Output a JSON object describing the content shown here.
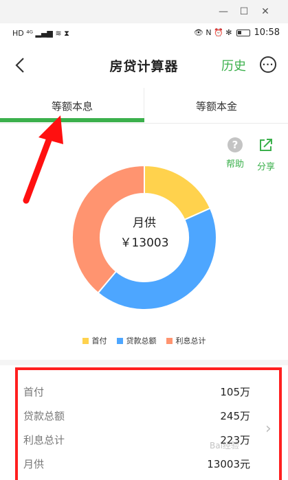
{
  "window": {
    "min": "—",
    "max": "☐",
    "close": "✕"
  },
  "status_bar": {
    "left_glyphs": "HD ⁴ᴳ ▂▄▆ ≋ ⧗",
    "right_glyphs": "👁 N ⏰ ✻",
    "time": "10:58"
  },
  "header": {
    "title": "房贷计算器",
    "history": "历史",
    "more": "···",
    "back": "‹"
  },
  "tabs": [
    {
      "label": "等额本息"
    },
    {
      "label": "等额本金"
    }
  ],
  "actions": {
    "help": "帮助",
    "share": "分享",
    "help_glyph": "?"
  },
  "chart_data": {
    "type": "pie",
    "center_label": "月供",
    "center_value": "￥13003",
    "categories": [
      "首付",
      "贷款总额",
      "利息总计"
    ],
    "values": [
      105,
      245,
      223
    ],
    "colors": [
      "#ffd24d",
      "#4da6ff",
      "#ff9470"
    ]
  },
  "summary": {
    "rows": [
      {
        "label": "首付",
        "value": "105万"
      },
      {
        "label": "贷款总额",
        "value": "245万"
      },
      {
        "label": "利息总计",
        "value": "223万"
      },
      {
        "label": "月供",
        "value": "13003元"
      }
    ],
    "chevron": "›"
  },
  "watermark": "Bai经验"
}
